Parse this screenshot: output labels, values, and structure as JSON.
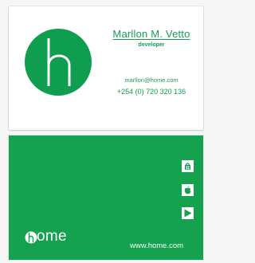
{
  "front": {
    "name": "Marllon M. Vetto",
    "role": "developer",
    "email": "marllon@home.com",
    "phone": "+254 (0) 720 320 136",
    "logo_icon": "h-monogram-logo-icon"
  },
  "back": {
    "brand_text": "ome",
    "website": "www.home.com",
    "store_icons": [
      "windows-store-icon",
      "apple-store-icon",
      "play-store-icon"
    ]
  },
  "colors": {
    "brand_green": "#14a24f",
    "text_green": "#1a9a55",
    "white": "#ffffff"
  }
}
